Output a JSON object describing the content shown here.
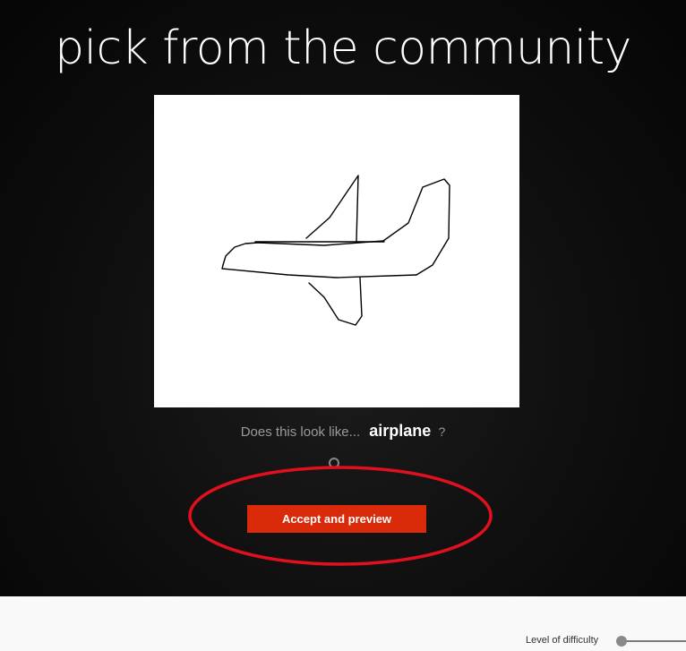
{
  "header": {
    "title": "pick from the community"
  },
  "drawing": {
    "subject_icon": "airplane-sketch"
  },
  "prompt": {
    "prefix": "Does this look like...",
    "word": "airplane",
    "suffix": "?"
  },
  "actions": {
    "accept_label": "Accept and preview"
  },
  "footer": {
    "difficulty_label": "Level of difficulty"
  },
  "colors": {
    "accent_button": "#d92b0a",
    "annotation_circle": "#e0101e",
    "stage_background": "#0e0e0e"
  }
}
